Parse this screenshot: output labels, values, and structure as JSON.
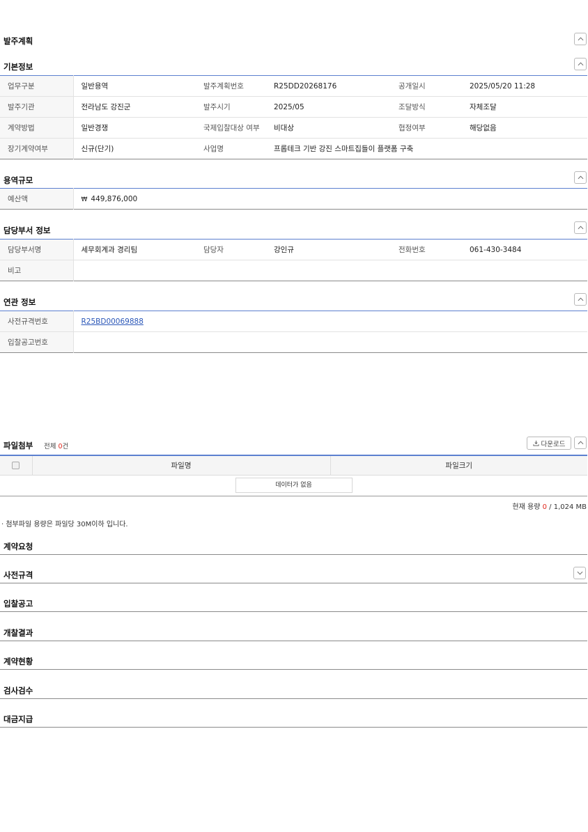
{
  "plan": {
    "title": "발주계획"
  },
  "basic": {
    "title": "기본정보",
    "rows": [
      [
        {
          "k": "업무구분",
          "v": "일반용역"
        },
        {
          "k": "발주계획번호",
          "v": "R25DD20268176"
        },
        {
          "k": "공개일시",
          "v": "2025/05/20 11:28"
        }
      ],
      [
        {
          "k": "발주기관",
          "v": "전라남도 강진군"
        },
        {
          "k": "발주시기",
          "v": "2025/05"
        },
        {
          "k": "조달방식",
          "v": "자체조달"
        }
      ],
      [
        {
          "k": "계약방법",
          "v": "일반경쟁"
        },
        {
          "k": "국제입찰대상 여부",
          "v": "비대상"
        },
        {
          "k": "협정여부",
          "v": "해당없음"
        }
      ]
    ],
    "last_row": {
      "k1": "장기계약여부",
      "v1": "신규(단기)",
      "k2": "사업명",
      "v2": "프롭테크 기반 강진 스마트집들이 플랫폼 구축"
    }
  },
  "scale": {
    "title": "용역규모",
    "budget_label": "예산액",
    "currency": "₩",
    "budget_value": "449,876,000"
  },
  "dept": {
    "title": "담당부서 정보",
    "dept_name_label": "담당부서명",
    "dept_name": "세무회계과 경리팀",
    "manager_label": "담당자",
    "manager": "강인규",
    "phone_label": "전화번호",
    "phone": "061-430-3484",
    "note_label": "비고",
    "note": ""
  },
  "related": {
    "title": "연관 정보",
    "spec_label": "사전규격번호",
    "spec_value": "R25BD00069888",
    "bid_label": "입찰공고번호",
    "bid_value": ""
  },
  "files": {
    "title": "파일첨부",
    "total_prefix": "전체 ",
    "total_count": "0",
    "total_suffix": "건",
    "download_label": "다운로드",
    "col_name": "파일명",
    "col_size": "파일크기",
    "empty_text": "데이터가 없음",
    "usage_label": "현재 용량",
    "usage_current": "0",
    "usage_sep": " / ",
    "usage_max": "1,024 MB",
    "note": "· 첨부파일 용량은 파일당 30M이하 입니다."
  },
  "stages": [
    {
      "title": "계약요청",
      "expandable": false
    },
    {
      "title": "사전규격",
      "expandable": true
    },
    {
      "title": "입찰공고",
      "expandable": false
    },
    {
      "title": "개찰결과",
      "expandable": false
    },
    {
      "title": "계약현황",
      "expandable": false
    },
    {
      "title": "검사검수",
      "expandable": false
    },
    {
      "title": "대금지급",
      "expandable": false
    }
  ],
  "colors": {
    "accent_blue": "#5b7fcf",
    "count_red": "#e0261b",
    "link": "#2b57b8"
  },
  "icons": {
    "collapse": "chevron-up-icon",
    "expand": "chevron-down-icon",
    "download": "download-icon"
  }
}
